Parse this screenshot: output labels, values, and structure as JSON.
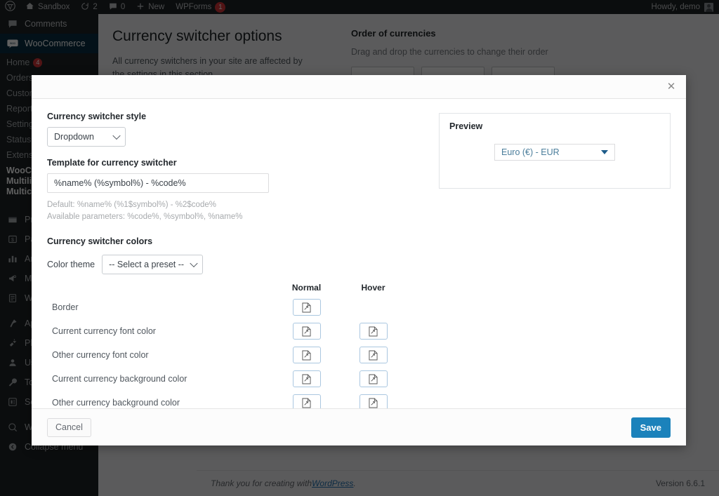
{
  "adminbar": {
    "logo_icon": "wordpress-logo-icon",
    "site_name": "Sandbox",
    "site_icon": "home-icon",
    "updates_icon": "updates-icon",
    "updates_count": "2",
    "comments_icon": "comment-icon",
    "comments_count": "0",
    "new_icon": "plus-icon",
    "new_label": "New",
    "wpforms_label": "WPForms",
    "wpforms_badge": "1",
    "howdy": "Howdy, demo",
    "avatar_icon": "avatar-icon"
  },
  "sidebar": {
    "items": [
      {
        "label": "Comments",
        "icon": "comment-icon",
        "current": false
      },
      {
        "label": "WooCommerce",
        "icon": "woocommerce-icon",
        "current": true
      }
    ],
    "woo_submenu": [
      {
        "label": "Home",
        "badge": "4"
      },
      {
        "label": "Orders",
        "badge": ""
      },
      {
        "label": "Customers",
        "badge": ""
      },
      {
        "label": "Reports",
        "badge": ""
      },
      {
        "label": "Settings",
        "badge": ""
      },
      {
        "label": "Status",
        "badge": ""
      },
      {
        "label": "Extensions",
        "badge": ""
      }
    ],
    "woo_active_sub": "WooCommerce Multilingual & Multicurrency",
    "lower_items": [
      {
        "label": "Products",
        "icon": "products-icon"
      },
      {
        "label": "Payments",
        "icon": "payments-icon"
      },
      {
        "label": "Analytics",
        "icon": "analytics-icon"
      },
      {
        "label": "Marketing",
        "icon": "marketing-icon"
      },
      {
        "label": "WPForms",
        "icon": "wpforms-icon"
      },
      {
        "label": "Appearance",
        "icon": "appearance-icon"
      },
      {
        "label": "Plugins",
        "icon": "plugins-icon"
      },
      {
        "label": "Users",
        "icon": "users-icon"
      },
      {
        "label": "Tools",
        "icon": "tools-icon"
      },
      {
        "label": "Settings",
        "icon": "settings-icon"
      },
      {
        "label": "WPML",
        "icon": "wpml-icon"
      },
      {
        "label": "Collapse menu",
        "icon": "collapse-icon"
      }
    ]
  },
  "background_page": {
    "heading": "Currency switcher options",
    "description": "All currency switchers in your site are affected by the settings in this section.",
    "order_heading": "Order of currencies",
    "order_description": "Drag and drop the currencies to change their order"
  },
  "footer": {
    "thanks_prefix": "Thank you for creating with ",
    "thanks_link": "WordPress",
    "thanks_suffix": ".",
    "version": "Version 6.6.1"
  },
  "modal": {
    "close_icon": "close-icon",
    "style_label": "Currency switcher style",
    "style_value": "Dropdown",
    "style_options": [
      "Dropdown"
    ],
    "template_label": "Template for currency switcher",
    "template_value": "%name% (%symbol%) - %code%",
    "template_placeholder": "%name% (%symbol%) - %code%",
    "hint_default": "Default: %name% (%1$symbol%) - %2$code%",
    "hint_params": "Available parameters: %code%, %symbol%, %name%",
    "colors_title": "Currency switcher colors",
    "theme_label": "Color theme",
    "theme_value": "-- Select a preset --",
    "theme_options": [
      "-- Select a preset --"
    ],
    "col_normal": "Normal",
    "col_hover": "Hover",
    "color_rows": [
      {
        "label": "Border",
        "normal": true,
        "hover": false
      },
      {
        "label": "Current currency font color",
        "normal": true,
        "hover": true
      },
      {
        "label": "Other currency font color",
        "normal": true,
        "hover": true
      },
      {
        "label": "Current currency background color",
        "normal": true,
        "hover": true
      },
      {
        "label": "Other currency background color",
        "normal": true,
        "hover": true
      }
    ],
    "swatch_icon": "broken-image-icon",
    "preview_title": "Preview",
    "preview_value": "Euro (€) - EUR",
    "preview_caret_icon": "triangle-down-icon",
    "cancel_label": "Cancel",
    "save_label": "Save"
  },
  "colors": {
    "save_button": "#1b82bb",
    "admin_dark": "#1d2327",
    "menu_current": "#0a2e42",
    "preview_text": "#4a7d9b",
    "badge_red": "#d63638"
  }
}
